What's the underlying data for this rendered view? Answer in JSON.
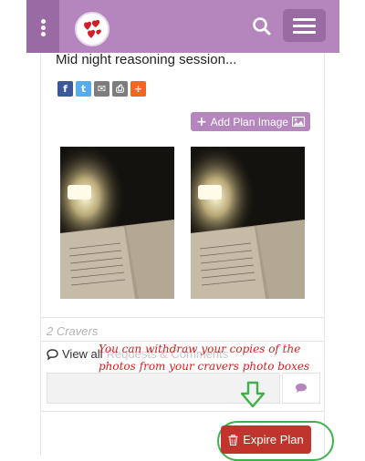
{
  "post": {
    "title": "Mid night reasoning session...",
    "share_buttons": [
      {
        "icon": "facebook-icon",
        "glyph": "f",
        "color": "#3b5998"
      },
      {
        "icon": "twitter-icon",
        "glyph": "t",
        "color": "#55acee"
      },
      {
        "icon": "email-icon",
        "glyph": "✉",
        "color": "#7d7d7d"
      },
      {
        "icon": "print-icon",
        "glyph": "⎙",
        "color": "#7d7d7d"
      },
      {
        "icon": "more-share-icon",
        "glyph": "+",
        "color": "#f26522"
      }
    ],
    "add_image_label": "Add Plan Image",
    "cravers_count": "2 Cravers",
    "view_all_label": "View all",
    "view_all_ghost": "Requests & Comments",
    "expire_label": "Expire Plan"
  },
  "annotation": {
    "text": "You can withdraw your copies of the photos from your cravers photo boxes"
  },
  "colors": {
    "header": "#b585be",
    "header_dark": "#9a6aa4",
    "expire": "#c0342d",
    "annotation": "#d42020",
    "highlight": "#3fb04a"
  }
}
